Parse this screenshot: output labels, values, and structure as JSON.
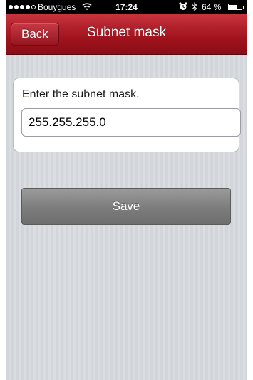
{
  "status_bar": {
    "carrier": "Bouygues",
    "signal_bars_filled": 4,
    "signal_bars_total": 5,
    "time": "17:24",
    "battery_percent_label": "64 %",
    "battery_level": 0.64,
    "icons": [
      "signal-dots-icon",
      "wifi-icon",
      "alarm-icon",
      "bluetooth-icon",
      "battery-icon"
    ]
  },
  "nav": {
    "back_label": "Back",
    "title": "Subnet mask"
  },
  "form": {
    "label": "Enter the subnet mask.",
    "subnet_value": "255.255.255.0"
  },
  "actions": {
    "save_label": "Save"
  },
  "colors": {
    "nav_bar": "#a0131d",
    "save_button": "#7c7c7c",
    "background": "#d9dbe0"
  }
}
